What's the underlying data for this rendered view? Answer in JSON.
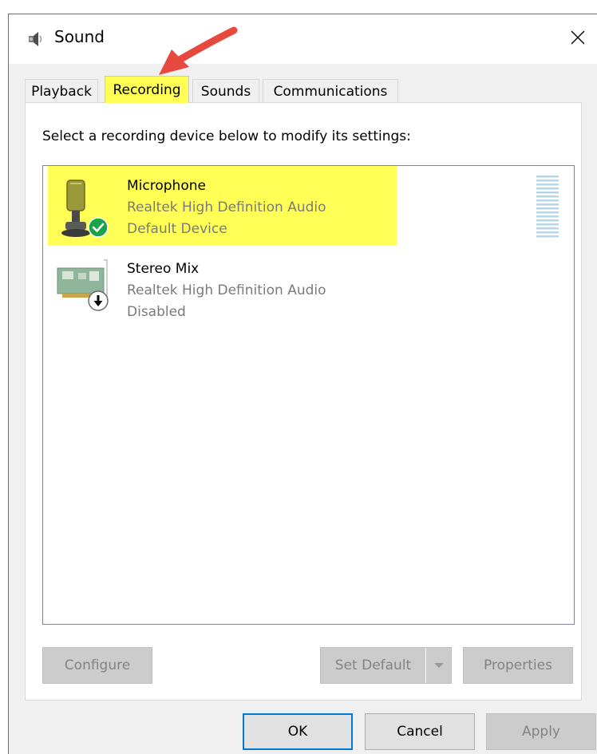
{
  "window": {
    "title": "Sound",
    "close_glyph": "✕"
  },
  "tabs": [
    {
      "label": "Playback",
      "active": false
    },
    {
      "label": "Recording",
      "active": true
    },
    {
      "label": "Sounds",
      "active": false
    },
    {
      "label": "Communications",
      "active": false
    }
  ],
  "recording": {
    "instruction": "Select a recording device below to modify its settings:",
    "devices": [
      {
        "name": "Microphone",
        "driver": "Realtek High Definition Audio",
        "status": "Default Device",
        "icon": "microphone-icon",
        "badge": "default-check-icon",
        "highlighted": true
      },
      {
        "name": "Stereo Mix",
        "driver": "Realtek High Definition Audio",
        "status": "Disabled",
        "icon": "sound-card-icon",
        "badge": "disabled-arrow-icon",
        "highlighted": false
      }
    ]
  },
  "panel_buttons": {
    "configure": "Configure",
    "set_default": "Set Default",
    "properties": "Properties"
  },
  "dialog_buttons": {
    "ok": "OK",
    "cancel": "Cancel",
    "apply": "Apply"
  },
  "colors": {
    "highlight": "#ffff55",
    "check_green": "#1aa34a",
    "annotation_arrow": "#e64a3f",
    "focus_border": "#0078d7",
    "meter": "#b7d7e8"
  }
}
